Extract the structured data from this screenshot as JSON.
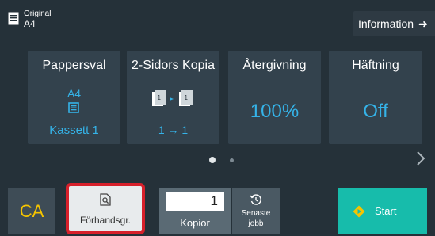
{
  "header": {
    "original_label": "Original",
    "original_size": "A4",
    "information_label": "Information"
  },
  "tiles": {
    "paper": {
      "title": "Pappersval",
      "size": "A4",
      "tray": "Kassett 1"
    },
    "duplex": {
      "title": "2-Sidors Kopia",
      "value": "1 → 1"
    },
    "zoom": {
      "title": "Återgivning",
      "value": "100%"
    },
    "staple": {
      "title": "Häftning",
      "value": "Off"
    }
  },
  "pager": {
    "current_page": 1,
    "total_pages": 2
  },
  "footer": {
    "ca_label": "CA",
    "preview_label": "Förhandsgr.",
    "copies_value": "1",
    "copies_label": "Kopior",
    "recent_label_line1": "Senaste",
    "recent_label_line2": "jobb",
    "start_label": "Start"
  },
  "colors": {
    "accent_blue": "#35b3e8",
    "ca_yellow": "#f5c400",
    "start_teal": "#17bcab",
    "highlight_red": "#d7202b"
  },
  "icons": [
    "original-document-icon",
    "arrow-right-icon",
    "paper-tray-icon",
    "duplex-copy-icon",
    "chevron-right-icon",
    "preview-magnifier-icon",
    "recent-jobs-icon",
    "start-diamond-icon"
  ]
}
